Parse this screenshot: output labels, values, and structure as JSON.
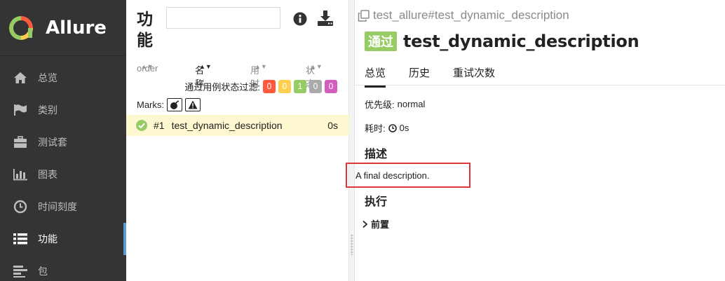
{
  "brand": {
    "name": "Allure"
  },
  "nav": [
    {
      "id": "overview",
      "label": "总览",
      "icon": "home-icon"
    },
    {
      "id": "categories",
      "label": "类别",
      "icon": "flag-icon"
    },
    {
      "id": "suites",
      "label": "测试套",
      "icon": "briefcase-icon"
    },
    {
      "id": "graphs",
      "label": "图表",
      "icon": "bar-chart-icon"
    },
    {
      "id": "timeline",
      "label": "时间刻度",
      "icon": "clock-icon"
    },
    {
      "id": "behaviors",
      "label": "功能",
      "icon": "list-icon",
      "active": true
    },
    {
      "id": "packages",
      "label": "包",
      "icon": "align-left-icon"
    }
  ],
  "middle": {
    "title": "功能",
    "search_placeholder": "",
    "sort": {
      "order": "order",
      "name": "名称",
      "duration": "用时",
      "status": "状态"
    },
    "filter_label": "通过用例状态过滤:",
    "status_counts": [
      {
        "label": "0",
        "color": "#fd5a3e"
      },
      {
        "label": "0",
        "color": "#ffd050"
      },
      {
        "label": "1",
        "color": "#97cc64"
      },
      {
        "label": "0",
        "color": "#aaaaaa"
      },
      {
        "label": "0",
        "color": "#d35ebe"
      }
    ],
    "marks_label": "Marks:",
    "test": {
      "number": "#1",
      "name": "test_dynamic_description",
      "duration": "0s"
    }
  },
  "detail": {
    "breadcrumb": "test_allure#test_dynamic_description",
    "status": "通过",
    "status_color": "#97cc64",
    "title": "test_dynamic_description",
    "tabs": [
      "总览",
      "历史",
      "重试次数"
    ],
    "severity_label": "优先级:",
    "severity_value": "normal",
    "duration_label": "耗时:",
    "duration_value": "0s",
    "description_heading": "描述",
    "description_text": "A final description.",
    "execution_heading": "执行",
    "setup_label": "前置"
  }
}
